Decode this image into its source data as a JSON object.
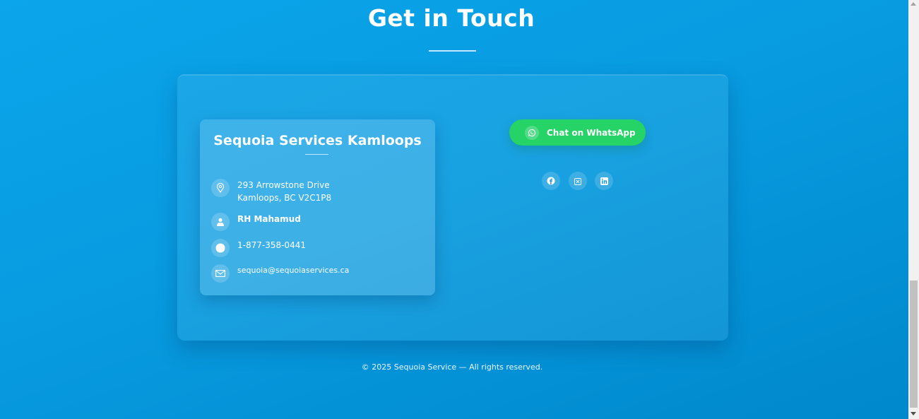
{
  "contact": {
    "title": "Get in Touch",
    "card": {
      "title": "Sequoia Services Kamloops",
      "address_line1": "293 Arrowstone Drive",
      "address_line2": "Kamloops, BC V2C1P8",
      "person": "RH Mahamud",
      "phone": "1-877-358-0441",
      "email": "sequoia@sequoiaservices.ca"
    },
    "whatsapp_label": "Chat on WhatsApp",
    "social": [
      "facebook-icon",
      "x-icon",
      "linkedin-icon"
    ]
  },
  "footer": {
    "text": "© 2025 Sequoia Service — All rights reserved."
  },
  "colors": {
    "background": "#089be0",
    "whatsapp": "#25d366",
    "text": "#ffffff"
  }
}
